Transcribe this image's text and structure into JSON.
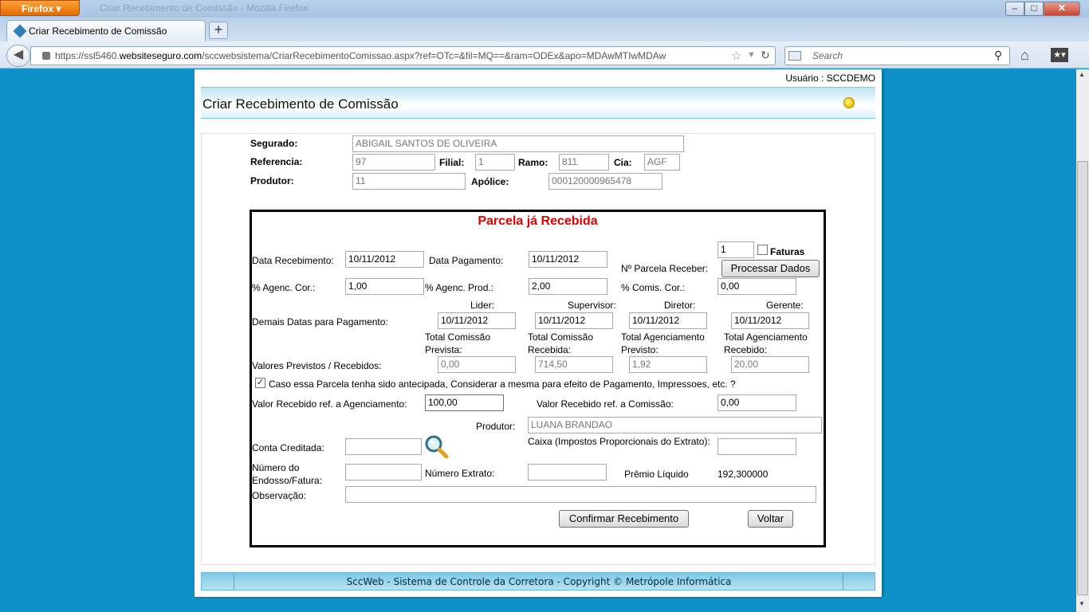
{
  "browser": {
    "app_button": "Firefox",
    "window_title": "Criar Recebimento de Comissão - Mozilla Firefox",
    "tab_title": "Criar Recebimento de Comissão",
    "new_tab": "+",
    "url_prefix": "https://ssl5460.",
    "url_domain": "websiteseguro.com",
    "url_rest": "/sccwebsistema/CriarRecebimentoComissao.aspx?ref=OTc=&fil=MQ==&ram=ODEx&apo=MDAwMTIwMDAw",
    "search_placeholder": "Search",
    "icons": [
      "back-icon",
      "lock-icon",
      "bookmark-star-icon",
      "reload-icon",
      "search-engine-icon",
      "search-icon",
      "home-icon",
      "bookmarks-menu-icon"
    ]
  },
  "header": {
    "user_label": "Usuário : SCCDEMO",
    "page_title": "Criar Recebimento de Comissão"
  },
  "policy": {
    "segurado_label": "Segurado:",
    "segurado_value": "ABIGAIL SANTOS DE OLIVEIRA",
    "referencia_label": "Referencia:",
    "referencia_value": "97",
    "filial_label": "Filial:",
    "filial_value": "1",
    "ramo_label": "Ramo:",
    "ramo_value": "811",
    "cia_label": "Cia:",
    "cia_value": "AGF",
    "produtor_label": "Produtor:",
    "produtor_value": "11",
    "apolice_label": "Apólice:",
    "apolice_value": "000120000965478"
  },
  "parcela": {
    "title": "Parcela já Recebida",
    "parcela_num": "1",
    "faturas_label": "Faturas",
    "data_recebimento_label": "Data Recebimento:",
    "data_recebimento": "10/11/2012",
    "data_pagamento_label": "Data Pagamento:",
    "data_pagamento": "10/11/2012",
    "parcela_receber_label": "Nº Parcela Receber:",
    "processar_button": "Processar Dados",
    "agenc_cor_label": "% Agenc. Cor.:",
    "agenc_cor": "1,00",
    "agenc_prod_label": "% Agenc. Prod.:",
    "agenc_prod": "2,00",
    "comis_cor_label": "% Comis. Cor.:",
    "comis_cor": "0,00",
    "lider_label": "Lider:",
    "supervisor_label": "Supervisor:",
    "diretor_label": "Diretor:",
    "gerente_label": "Gerente:",
    "demais_datas_label": "Demais Datas para Pagamento:",
    "lider_date": "10/11/2012",
    "supervisor_date": "10/11/2012",
    "diretor_date": "10/11/2012",
    "gerente_date": "10/11/2012",
    "total_comissao_prevista_label": "Total Comissão Prevista:",
    "total_comissao_recebida_label": "Total Comissão Recebida:",
    "total_agenciamento_previsto_label": "Total Agenciamento Previsto:",
    "total_agenciamento_recebido_label": "Total Agenciamento Recebido:",
    "valores_label": "Valores Previstos / Recebidos:",
    "total_comissao_prevista": "0,00",
    "total_comissao_recebida": "714,50",
    "total_agenciamento_previsto": "1,92",
    "total_agenciamento_recebido": "20,00",
    "antecipada_checked": true,
    "antecipada_label": "Caso essa Parcela tenha sido antecipada, Considerar a mesma para efeito de Pagamento, Impressoes, etc. ?",
    "valor_agenciamento_label": "Valor Recebido ref. a Agenciamento:",
    "valor_agenciamento": "100,00",
    "valor_comissao_label": "Valor Recebido ref. a Comissão:",
    "valor_comissao": "0,00",
    "produtor_label": "Produtor:",
    "produtor_nome": "LUANA BRANDAO",
    "conta_creditada_label": "Conta Creditada:",
    "conta_creditada": "",
    "caixa_label": "Caixa (Impostos Proporcionais do Extrato):",
    "caixa": "",
    "numero_endosso_label": "Número do Endosso/Fatura:",
    "numero_endosso": "",
    "numero_extrato_label": "Número Extrato:",
    "numero_extrato": "",
    "premio_liquido_label": "Prêmio Líquido",
    "premio_liquido": "192,300000",
    "observacao_label": "Observação:",
    "observacao": "",
    "confirmar_button": "Confirmar Recebimento",
    "voltar_button": "Voltar"
  },
  "footer": {
    "text": "SccWeb - Sistema de Controle da Corretora - Copyright © Metrópole Informática"
  },
  "colors": {
    "page_background": "#0e91c9",
    "parcela_title": "#e00000",
    "header_band": "#bfe6f4"
  }
}
